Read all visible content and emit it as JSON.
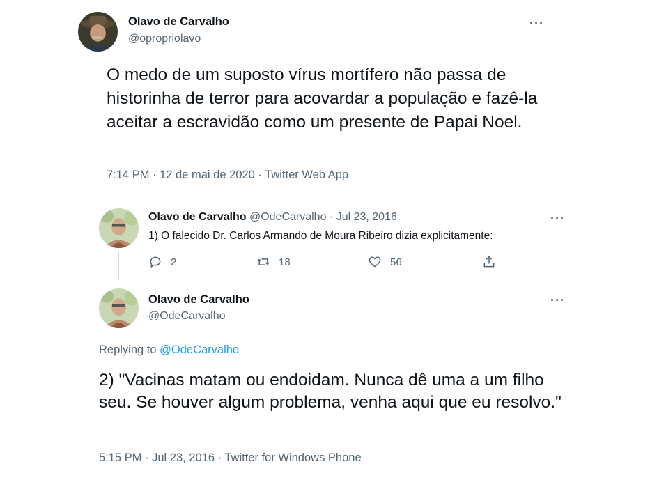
{
  "tweet1": {
    "author_name": "Olavo de Carvalho",
    "author_handle": "@opropriolavo",
    "more_label": "···",
    "text": "O medo de um suposto vírus mortífero não passa de historinha de terror para acovardar a população e fazê-la aceitar a escravidão como um presente de Papai Noel.",
    "meta": "7:14 PM · 12 de mai de 2020 · Twitter Web App"
  },
  "tweet2": {
    "author_name": "Olavo de Carvalho",
    "author_handle": "@OdeCarvalho",
    "date": "· Jul 23, 2016",
    "more_label": "···",
    "text": "1) O falecido Dr. Carlos Armando de Moura Ribeiro dizia explicitamente:",
    "actions": {
      "reply_count": "2",
      "retweet_count": "18",
      "like_count": "56"
    }
  },
  "tweet3": {
    "author_name": "Olavo de Carvalho",
    "author_handle": "@OdeCarvalho",
    "more_label": "···",
    "replying_prefix": "Replying to ",
    "replying_handle": "@OdeCarvalho",
    "text": "2) \"Vacinas matam ou endoidam. Nunca dê uma a um filho seu. Se houver algum problema, venha aqui que eu resolvo.\"",
    "meta": "5:15 PM · Jul 23, 2016 · Twitter for Windows Phone"
  },
  "colors": {
    "text": "#0f1419",
    "muted": "#536471",
    "link": "#1d9bf0",
    "thread_line": "#cfd9de"
  }
}
